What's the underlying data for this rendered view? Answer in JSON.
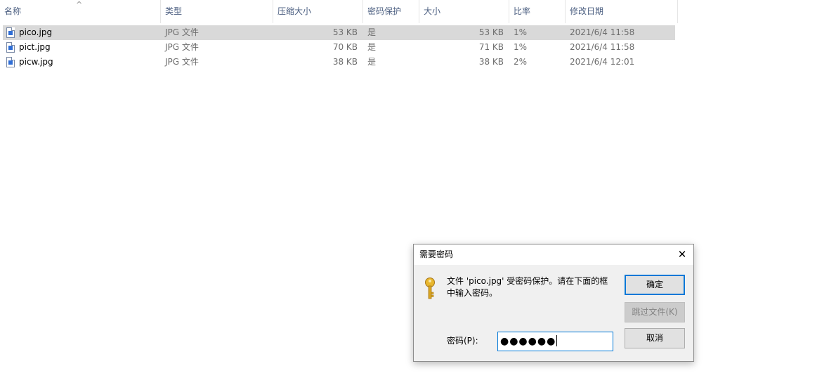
{
  "columns": [
    "名称",
    "类型",
    "压缩大小",
    "密码保护",
    "大小",
    "比率",
    "修改日期"
  ],
  "sort_arrow": "^",
  "files": [
    {
      "name": "pico.jpg",
      "type": "JPG 文件",
      "packed": "53 KB",
      "protected": "是",
      "size": "53 KB",
      "ratio": "1%",
      "modified": "2021/6/4 11:58"
    },
    {
      "name": "pict.jpg",
      "type": "JPG 文件",
      "packed": "70 KB",
      "protected": "是",
      "size": "71 KB",
      "ratio": "1%",
      "modified": "2021/6/4 11:58"
    },
    {
      "name": "picw.jpg",
      "type": "JPG 文件",
      "packed": "38 KB",
      "protected": "是",
      "size": "38 KB",
      "ratio": "2%",
      "modified": "2021/6/4 12:01"
    }
  ],
  "selected_row": "pico.jpg",
  "dialog": {
    "title": "需要密码",
    "close": "✕",
    "message": "文件 'pico.jpg' 受密码保护。请在下面的框中输入密码。",
    "password_label": "密码(P):",
    "password_value": "●●●●●●",
    "ok": "确定",
    "skip": "跳过文件(K)",
    "cancel": "取消"
  },
  "colors": {
    "header_text": "#4d6082",
    "selected_row": "#d9d9d9",
    "focus_blue": "#0078d7",
    "key_gold": "#d9a520"
  }
}
